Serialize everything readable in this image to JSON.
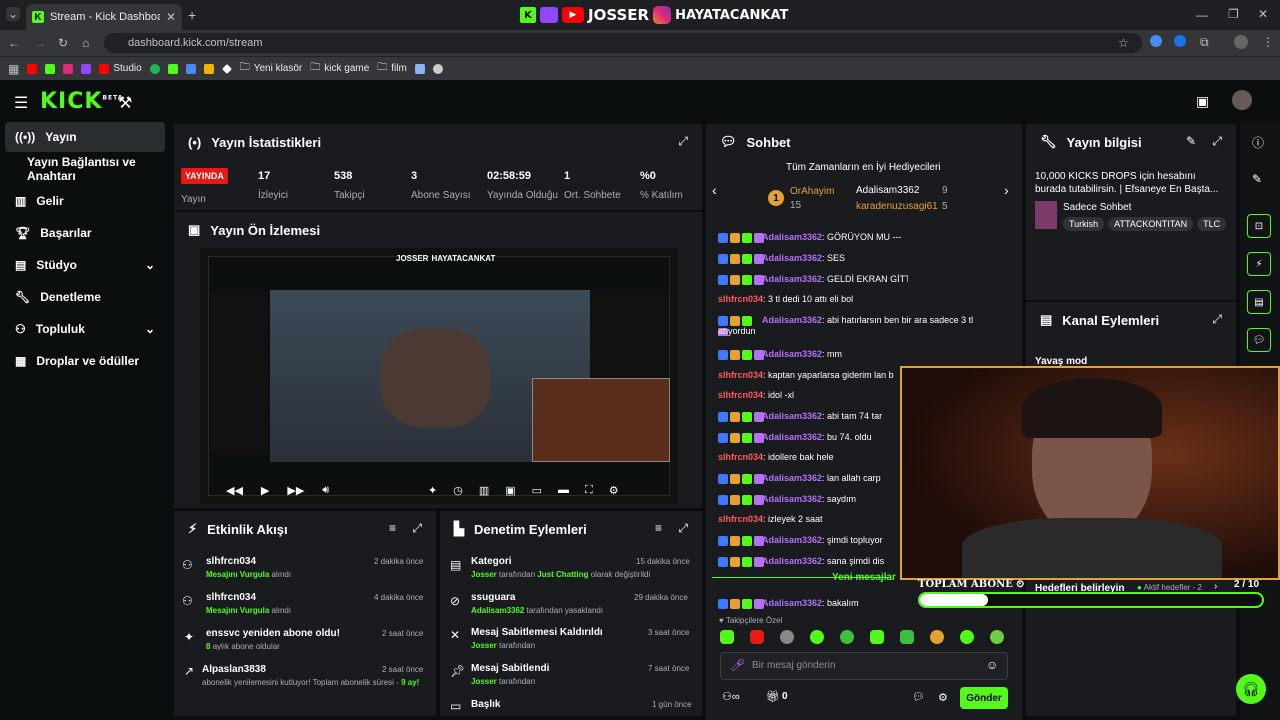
{
  "browser": {
    "tab_title": "Stream - Kick Dashboard",
    "url": "dashboard.kick.com/stream",
    "bookmarks": [
      "Studio",
      "Yeni klasör",
      "kick game",
      "film"
    ]
  },
  "overlay": {
    "name1": "JOSSER",
    "name2": "HAYATACANKAT"
  },
  "nav": {
    "logo": "KICK",
    "logo_beta": "BETA"
  },
  "sidebar": {
    "items": [
      {
        "label": "Yayın"
      },
      {
        "label": "Yayın Bağlantısı ve Anahtarı"
      },
      {
        "label": "Gelir"
      },
      {
        "label": "Başarılar"
      },
      {
        "label": "Stüdyo"
      },
      {
        "label": "Denetleme"
      },
      {
        "label": "Topluluk"
      },
      {
        "label": "Droplar ve ödüller"
      }
    ]
  },
  "stats": {
    "title": "Yayın İstatistikleri",
    "live_badge": "YAYINDA",
    "live_label": "Yayın",
    "items": [
      {
        "value": "17",
        "label": "İzleyici"
      },
      {
        "value": "538",
        "label": "Takipçi"
      },
      {
        "value": "3",
        "label": "Abone Sayısı"
      },
      {
        "value": "02:58:59",
        "label": "Yayında Olduğu"
      },
      {
        "value": "1",
        "label": "Ort. Sohbete"
      },
      {
        "value": "%0",
        "label": "% Katılım"
      }
    ]
  },
  "preview": {
    "title": "Yayın Ön İzlemesi",
    "overlay_name": "JOSSER",
    "overlay_name2": "HAYATACANKAT"
  },
  "activity": {
    "title": "Etkinlik Akışı",
    "items": [
      {
        "name": "slhfrcn034",
        "sub_pre": "Mesajını Vurgula",
        "sub_post": "alındı",
        "time": "2 dakika önce"
      },
      {
        "name": "slhfrcn034",
        "sub_pre": "Mesajını Vurgula",
        "sub_post": "alındı",
        "time": "4 dakika önce"
      },
      {
        "name": "enssvc yeniden abone oldu!",
        "sub_pre": "8",
        "sub_post": "aylık abone oldular",
        "time": "2 saat önce"
      },
      {
        "name": "Alpaslan3838",
        "sub_pre": "abonelik yenilemesini kutluyor! Toplam abonelik süresi -",
        "sub_post": "9 ay!",
        "time": "2 saat önce"
      }
    ]
  },
  "moderation": {
    "title": "Denetim Eylemleri",
    "items": [
      {
        "title": "Kategori",
        "who": "Josser",
        "mid": "tarafından",
        "target": "Just Chatting",
        "post": "olarak değiştirildi",
        "time": "15 dakika önce"
      },
      {
        "title": "ssuguara",
        "who": "Adalisam3362",
        "mid": "tarafından yasaklandı",
        "target": "",
        "post": "",
        "time": "29 dakika önce"
      },
      {
        "title": "Mesaj Sabitlemesi Kaldırıldı",
        "who": "Josser",
        "mid": "tarafından",
        "target": "",
        "post": "",
        "time": "3 saat önce"
      },
      {
        "title": "Mesaj Sabitlendi",
        "who": "Josser",
        "mid": "tarafından",
        "target": "",
        "post": "",
        "time": "7 saat önce"
      },
      {
        "title": "Başlık",
        "who": "",
        "mid": "",
        "target": "",
        "post": "",
        "time": "1 gün önce"
      }
    ]
  },
  "chat": {
    "title": "Sohbet",
    "gifters_title": "Tüm Zamanların en İyi Hediyecileri",
    "gifters": [
      {
        "rank": "1",
        "name": "OrAhayim",
        "count": "15"
      },
      {
        "name": "Adalisam3362",
        "count": "9"
      },
      {
        "name": "karadenuzusagi61",
        "count": "5"
      }
    ],
    "messages": [
      {
        "user": "Adalisam3362",
        "text": ": GÖRÜYON MU ---",
        "mod": true
      },
      {
        "user": "Adalisam3362",
        "text": ": SES",
        "mod": true
      },
      {
        "user": "Adalisam3362",
        "text": ": GELDİ EKRAN GİTTİ",
        "mod": true
      },
      {
        "user": "slhfrcn034",
        "text": ": 3 tl dedi 10 attı eli bol",
        "mod": false
      },
      {
        "user": "Adalisam3362",
        "text": ": abi hatırlarsın ben bir ara sadece 3 tl",
        "text2": "atıyordun",
        "mod": true
      },
      {
        "user": "Adalisam3362",
        "text": ": mm",
        "mod": true
      },
      {
        "user": "slhfrcn034",
        "text": ": kaptan yaparlarsa giderim lan b",
        "mod": false
      },
      {
        "user": "slhfrcn034",
        "text": ": idol -xl",
        "mod": false
      },
      {
        "user": "Adalisam3362",
        "text": ": abi tam 74 tar",
        "mod": true
      },
      {
        "user": "Adalisam3362",
        "text": ": bu 74. oldu",
        "mod": true
      },
      {
        "user": "slhfrcn034",
        "text": ": idollere bak hele",
        "mod": false
      },
      {
        "user": "Adalisam3362",
        "text": ": lan allah carp",
        "mod": true
      },
      {
        "user": "Adalisam3362",
        "text": ": saydım",
        "mod": true
      },
      {
        "user": "slhfrcn034",
        "text": ": izleyek 2 saat",
        "mod": false
      },
      {
        "user": "Adalisam3362",
        "text": ": şimdi topluyor",
        "mod": true
      },
      {
        "user": "Adalisam3362",
        "text": ": sana şimdi dis",
        "mod": true
      },
      {
        "user": "Adalisam3362",
        "text": ": bakalım",
        "mod": true
      }
    ],
    "new_messages": "Yeni mesajlar",
    "followers_only": "Takipçilere Özel",
    "input_placeholder": "Bir mesaj gönderin",
    "send": "Gönder",
    "points": "0"
  },
  "info": {
    "title": "Yayın bilgisi",
    "stream_title": "10,000 KICKS DROPS için hesabını burada tutabilirsin. | Efsaneye En Başta...",
    "category": "Sadece Sohbet",
    "tags": [
      "Turkish",
      "ATTACKONTITAN",
      "TLC"
    ]
  },
  "channel_actions": {
    "title": "Kanal Eylemleri",
    "first": "Yavaş mod"
  },
  "sub_goal": {
    "label": "TOPLAM ABONE",
    "progress_text": "2 / 10",
    "progress": 0.2,
    "goals_link": "Hedefleri belirleyin",
    "active_goals": "Aktif hedefler - 2"
  },
  "colors": {
    "accent": "#53fc18",
    "panel": "#191b1f",
    "live": "#e91916"
  }
}
